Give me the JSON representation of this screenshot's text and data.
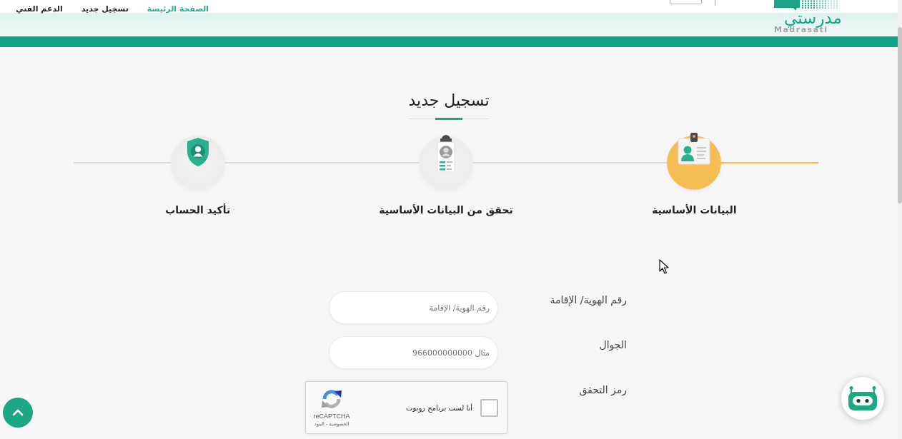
{
  "header": {
    "logo": {
      "name": "مدرستي",
      "latin": "Madrasati"
    },
    "nav": [
      {
        "label": "الصفحة الرئيسة",
        "selected": true
      },
      {
        "label": "تسجيل جديد",
        "selected": false
      },
      {
        "label": "الدعم الفني",
        "selected": false
      }
    ]
  },
  "title": "تسجيل جديد",
  "steps": [
    {
      "label": "البيانات الأساسية",
      "selected": true
    },
    {
      "label": "تحقق من البيانات الأساسية",
      "selected": false
    },
    {
      "label": "تأكيد الحساب",
      "selected": false
    }
  ],
  "form": {
    "fields": [
      {
        "kind": "text",
        "label": "رقم الهوية/ الإقامة",
        "placeholder": "رقم الهوية/ الإقامة"
      },
      {
        "kind": "text",
        "label": "الجوال",
        "placeholder": "مثال 966000000000"
      },
      {
        "kind": "captcha",
        "label": "رمز التحقق",
        "checked": false,
        "prompt": "أنا لست برنامج روبوت",
        "brand": "reCAPTCHA",
        "links": "الخصوصية - البنود"
      }
    ]
  }
}
